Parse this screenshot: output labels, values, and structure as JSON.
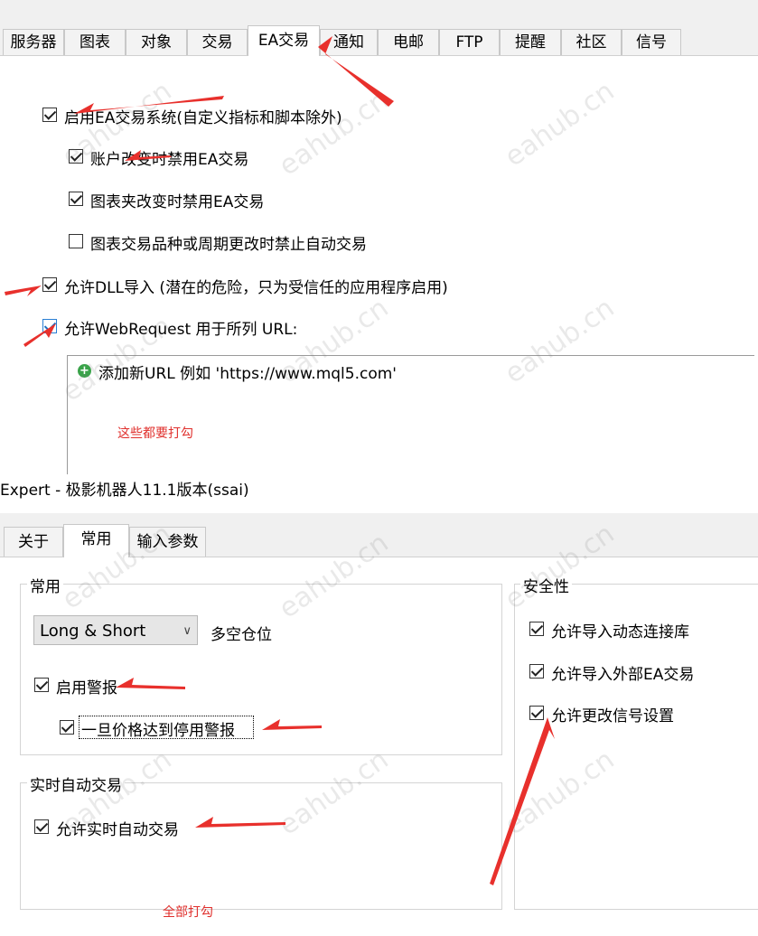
{
  "top_options": {
    "tabs": [
      "服务器",
      "图表",
      "对象",
      "交易",
      "EA交易",
      "通知",
      "电邮",
      "FTP",
      "提醒",
      "社区",
      "信号"
    ],
    "active_tab": "EA交易",
    "checkboxes": [
      {
        "label": "启用EA交易系统(自定义指标和脚本除外)",
        "checked": true
      },
      {
        "label": "账户改变时禁用EA交易",
        "checked": true
      },
      {
        "label": "图表夹改变时禁用EA交易",
        "checked": true
      },
      {
        "label": "图表交易品种或周期更改时禁止自动交易",
        "checked": false
      },
      {
        "label": "允许DLL导入 (潜在的危险，只为受信任的应用程序启用)",
        "checked": true
      },
      {
        "label": "允许WebRequest 用于所列 URL:",
        "checked": true
      }
    ],
    "add_url_label": "添加新URL 例如 'https://www.mql5.com'",
    "note": "这些都要打勾"
  },
  "expert": {
    "title": "Expert - 极影机器人11.1版本(ssai)",
    "tabs": [
      "关于",
      "常用",
      "输入参数"
    ],
    "active_tab": "常用",
    "common_group": {
      "title": "常用",
      "select_value": "Long & Short",
      "select_caption": "多空仓位",
      "enable_alerts": "启用警报",
      "disable_on_price": "一旦价格达到停用警报"
    },
    "realtime_group": {
      "title": "实时自动交易",
      "allow_realtime": "允许实时自动交易"
    },
    "security_group": {
      "title": "安全性",
      "items": [
        "允许导入动态连接库",
        "允许导入外部EA交易",
        "允许更改信号设置"
      ]
    },
    "note": "全部打勾"
  },
  "watermark_text": "eahub.cn",
  "annotation_color": "#e8302c"
}
